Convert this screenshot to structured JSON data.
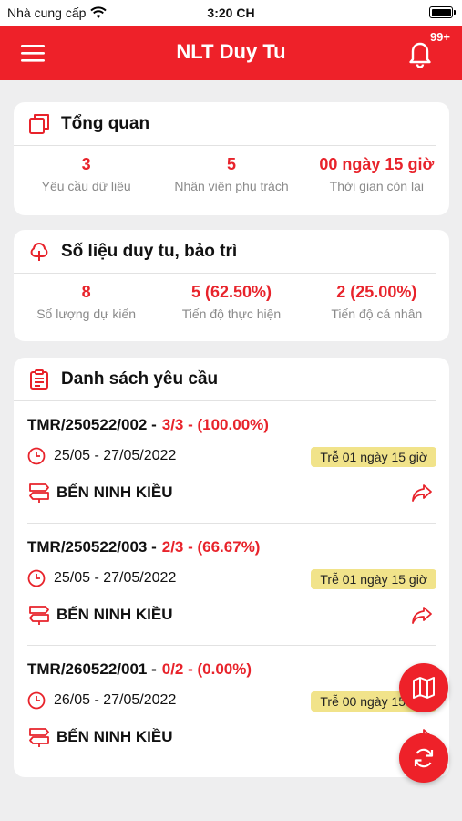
{
  "status_bar": {
    "carrier": "Nhà cung cấp",
    "time": "3:20 CH"
  },
  "header": {
    "title": "NLT Duy Tu",
    "notification_badge": "99+"
  },
  "overview": {
    "title": "Tổng quan",
    "stats": [
      {
        "value": "3",
        "label": "Yêu cầu dữ liệu"
      },
      {
        "value": "5",
        "label": "Nhân viên phụ trách"
      },
      {
        "value": "00 ngày 15 giờ",
        "label": "Thời gian còn lại"
      }
    ]
  },
  "maintenance": {
    "title": "Số liệu duy tu, bảo trì",
    "stats": [
      {
        "value": "8",
        "label": "Số lượng dự kiến"
      },
      {
        "value": "5 (62.50%)",
        "label": "Tiến độ thực hiện"
      },
      {
        "value": "2 (25.00%)",
        "label": "Tiến độ cá nhân"
      }
    ]
  },
  "requests": {
    "title": "Danh sách yêu cầu",
    "items": [
      {
        "code": "TMR/250522/002 -",
        "progress": "3/3 - (100.00%)",
        "date": "25/05 - 27/05/2022",
        "late": "Trễ 01 ngày 15 giờ",
        "location": "BẾN NINH KIỀU"
      },
      {
        "code": "TMR/250522/003 -",
        "progress": "2/3 - (66.67%)",
        "date": "25/05 - 27/05/2022",
        "late": "Trễ 01 ngày 15 giờ",
        "location": "BẾN NINH KIỀU"
      },
      {
        "code": "TMR/260522/001 -",
        "progress": "0/2 - (0.00%)",
        "date": "26/05 - 27/05/2022",
        "late": "Trễ 00 ngày 15 giờ",
        "location": "BẾN NINH KIỀU"
      }
    ]
  },
  "colors": {
    "brand": "#ee2129",
    "late_badge": "#f1e38a"
  }
}
